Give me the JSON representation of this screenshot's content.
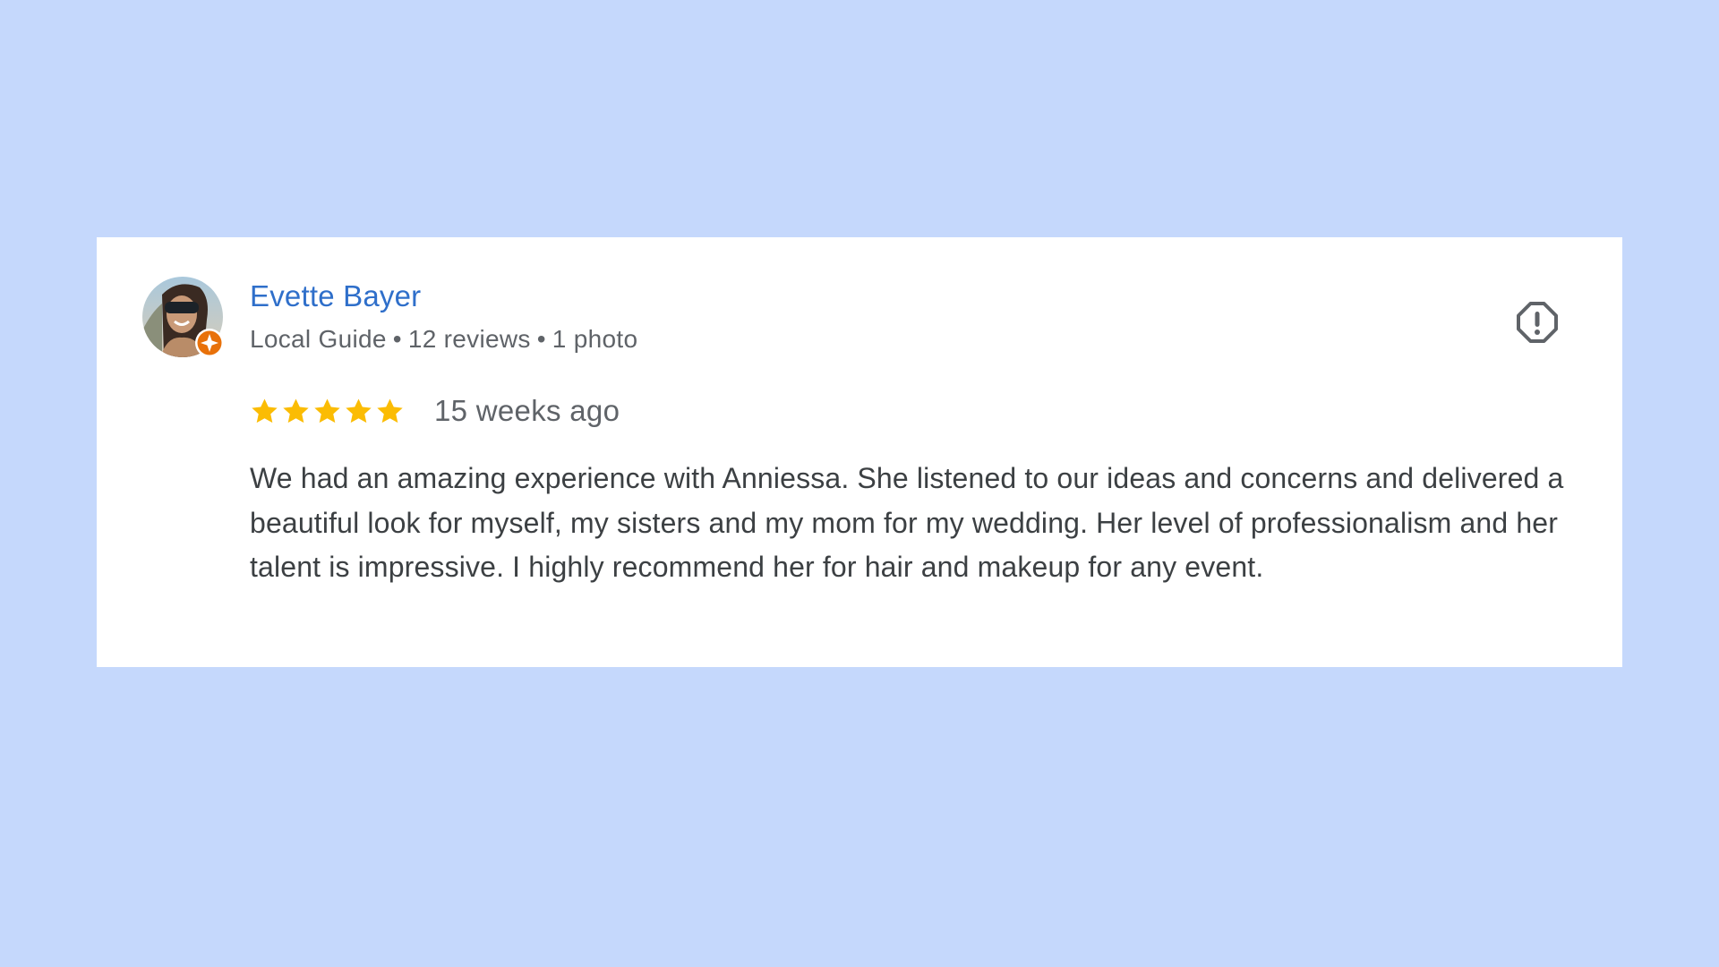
{
  "review": {
    "reviewer": {
      "name": "Evette Bayer",
      "badge": "Local Guide",
      "reviews": "12 reviews",
      "photos": "1 photo",
      "separator": "•"
    },
    "rating": 5,
    "rating_max": 5,
    "date": "15 weeks ago",
    "text": "We had an amazing experience with Anniessa. She listened to our ideas and concerns and delivered a beautiful look for myself, my sisters and my mom for my wedding. Her level of professionalism and her talent is impressive. I highly recommend her for hair and makeup for any event.",
    "icons": {
      "report": "report-flag-icon",
      "star": "star-icon",
      "badge": "local-guide-badge-icon"
    }
  },
  "colors": {
    "page_background": "#c5d8fc",
    "card_background": "#ffffff",
    "reviewer_name": "#2f6fca",
    "secondary_text": "#5f6368",
    "body_text": "#3c4043",
    "star_filled": "#fbbc04",
    "local_guide_badge": "#e8710a",
    "report_icon": "#5f6368"
  }
}
